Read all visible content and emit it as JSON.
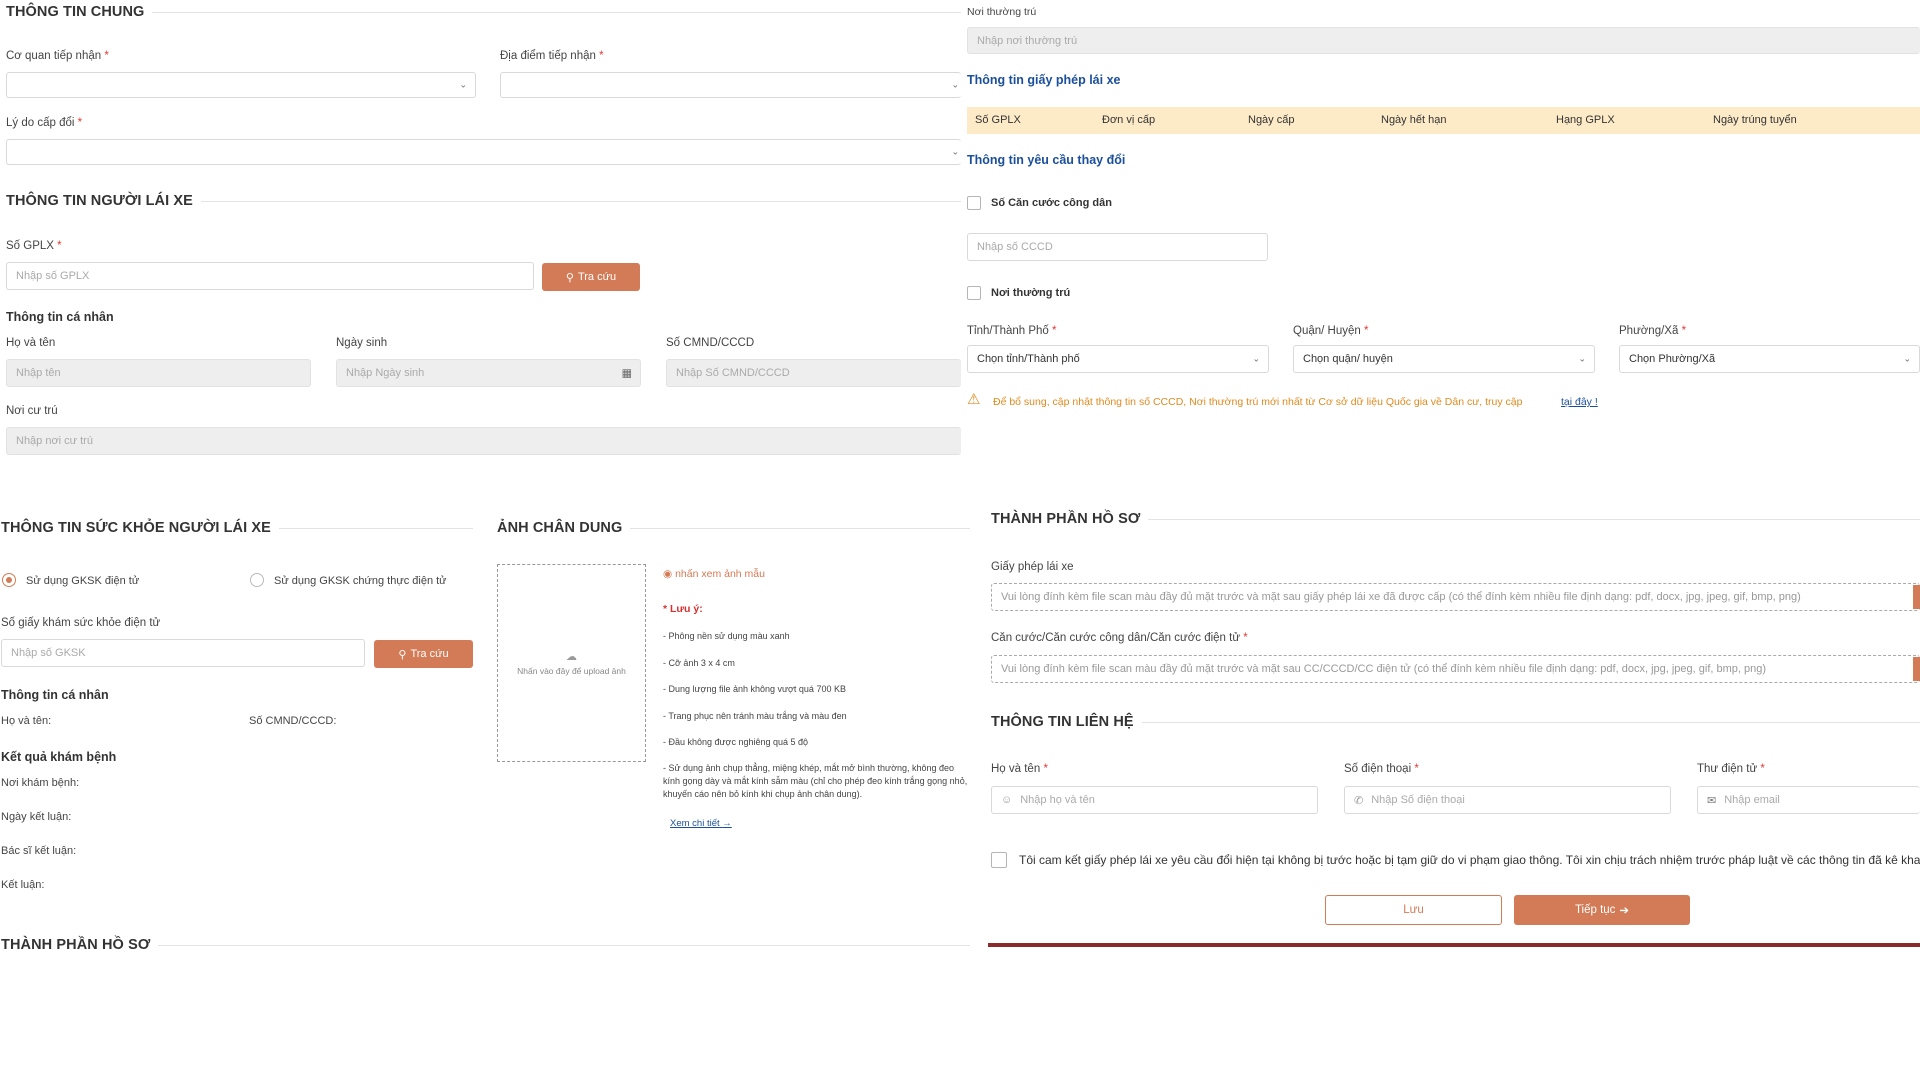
{
  "general": {
    "title": "THÔNG TIN CHUNG",
    "agency_label": "Cơ quan tiếp nhận",
    "location_label": "Địa điểm tiếp nhận",
    "reason_label": "Lý do cấp đổi"
  },
  "driver": {
    "title": "THÔNG TIN NGƯỜI LÁI XE",
    "gplx_label": "Số GPLX",
    "gplx_placeholder": "Nhập số GPLX",
    "lookup_label": "Tra cứu",
    "personal_title": "Thông tin cá nhân",
    "name_label": "Họ và tên",
    "name_placeholder": "Nhập tên",
    "dob_label": "Ngày sinh",
    "dob_placeholder": "Nhập Ngày sinh",
    "id_label": "Số CMND/CCCD",
    "id_placeholder": "Nhập Số CMND/CCCD",
    "residence_label": "Nơi cư trú",
    "residence_placeholder": "Nhập nơi cư trú"
  },
  "right_top": {
    "permanent_label": "Nơi thường trú",
    "permanent_placeholder": "Nhập nơi thường trú",
    "license_title": "Thông tin giấy phép lái xe",
    "table_headers": [
      "Số GPLX",
      "Đơn vị cấp",
      "Ngày cấp",
      "Ngày hết hạn",
      "Hạng GPLX",
      "Ngày trúng tuyển"
    ],
    "change_title": "Thông tin yêu cầu thay đổi",
    "cccd_check_label": "Số Căn cước công dân",
    "cccd_placeholder": "Nhập số CCCD",
    "permanent_check_label": "Nơi thường trú",
    "province_label": "Tỉnh/Thành Phố",
    "province_value": "Chọn tỉnh/Thành phố",
    "district_label": "Quận/ Huyện",
    "district_value": "Chọn quận/ huyện",
    "ward_label": "Phường/Xã",
    "ward_value": "Chọn Phường/Xã",
    "warning_text": "Để bổ sung, cập nhật thông tin số CCCD, Nơi thường trú mới nhất từ Cơ sở dữ liệu Quốc gia về Dân cư, truy cập",
    "warning_link": "tại đây !"
  },
  "health": {
    "title": "THÔNG TIN SỨC KHỎE NGƯỜI LÁI XE",
    "radio_electronic": "Sử dụng GKSK điện tử",
    "radio_certified": "Sử dụng GKSK chứng thực điện tử",
    "gksk_label": "Số giấy khám sức khỏe điện tử",
    "gksk_placeholder": "Nhập số GKSK",
    "lookup_label": "Tra cứu",
    "personal_title": "Thông tin cá nhân",
    "name_kv": "Họ và tên:",
    "id_kv": "Số CMND/CCCD:",
    "result_title": "Kết quả khám bệnh",
    "place_kv": "Nơi khám bệnh:",
    "date_kv": "Ngày kết luận:",
    "doctor_kv": "Bác sĩ kết luận:",
    "conclusion_kv": "Kết luận:"
  },
  "portrait": {
    "title": "ẢNH CHÂN DUNG",
    "upload_text": "Nhấn vào đây để upload ảnh",
    "sample_link": "nhấn xem ảnh mẫu",
    "note_title": "* Lưu ý:",
    "notes": [
      "- Phông nền sử dụng màu xanh",
      "- Cỡ ảnh 3 x 4 cm",
      "- Dung lượng file ảnh không vượt quá 700 KB",
      "- Trang phục nên tránh màu trắng và màu đen",
      "- Đầu không được nghiêng quá 5 độ",
      "- Sử dụng ảnh chụp thẳng, miệng khép, mắt mở bình thường, không đeo kính gọng dày và mắt kính sẫm màu (chỉ cho phép đeo kính trắng gọng nhỏ, khuyến cáo nên bỏ kính khi chụp ảnh chân dung)."
    ],
    "detail_link": "Xem chi tiết"
  },
  "bottom_left": {
    "dossier_title": "THÀNH PHẦN HỒ SƠ"
  },
  "dossier": {
    "title": "THÀNH PHẦN HỒ SƠ",
    "license_label": "Giấy phép lái xe",
    "license_placeholder": "Vui lòng đính kèm file scan màu đầy đủ mặt trước và mặt sau giấy phép lái xe đã được cấp (có thể đính kèm nhiều file định dạng: pdf, docx, jpg, jpeg, gif, bmp, png)",
    "id_label": "Căn cước/Căn cước công dân/Căn cước điện tử",
    "id_placeholder": "Vui lòng đính kèm file scan màu đầy đủ mặt trước và mặt sau CC/CCCD/CC điện tử (có thể đính kèm nhiều file định dạng: pdf, docx, jpg, jpeg, gif, bmp, png)"
  },
  "contact": {
    "title": "THÔNG TIN LIÊN HỆ",
    "name_label": "Họ và tên",
    "name_placeholder": "Nhập họ và tên",
    "phone_label": "Số điện thoại",
    "phone_placeholder": "Nhập Số điện thoại",
    "email_label": "Thư điện tử",
    "email_placeholder": "Nhập email",
    "commit_text": "Tôi cam kết giấy phép lái xe yêu cầu đổi hiện tại không bị tước hoặc bị tạm giữ do vi phạm giao thông. Tôi xin chịu trách nhiệm trước pháp luật về các thông tin đã kê khai",
    "save_label": "Lưu",
    "continue_label": "Tiếp tục"
  },
  "colors": {
    "accent": "#d27b56",
    "blue": "#1b4f9c",
    "table_header_bg": "#fdebc8",
    "warning": "#e08a1e",
    "bottom_rule": "#8b2b2b"
  }
}
